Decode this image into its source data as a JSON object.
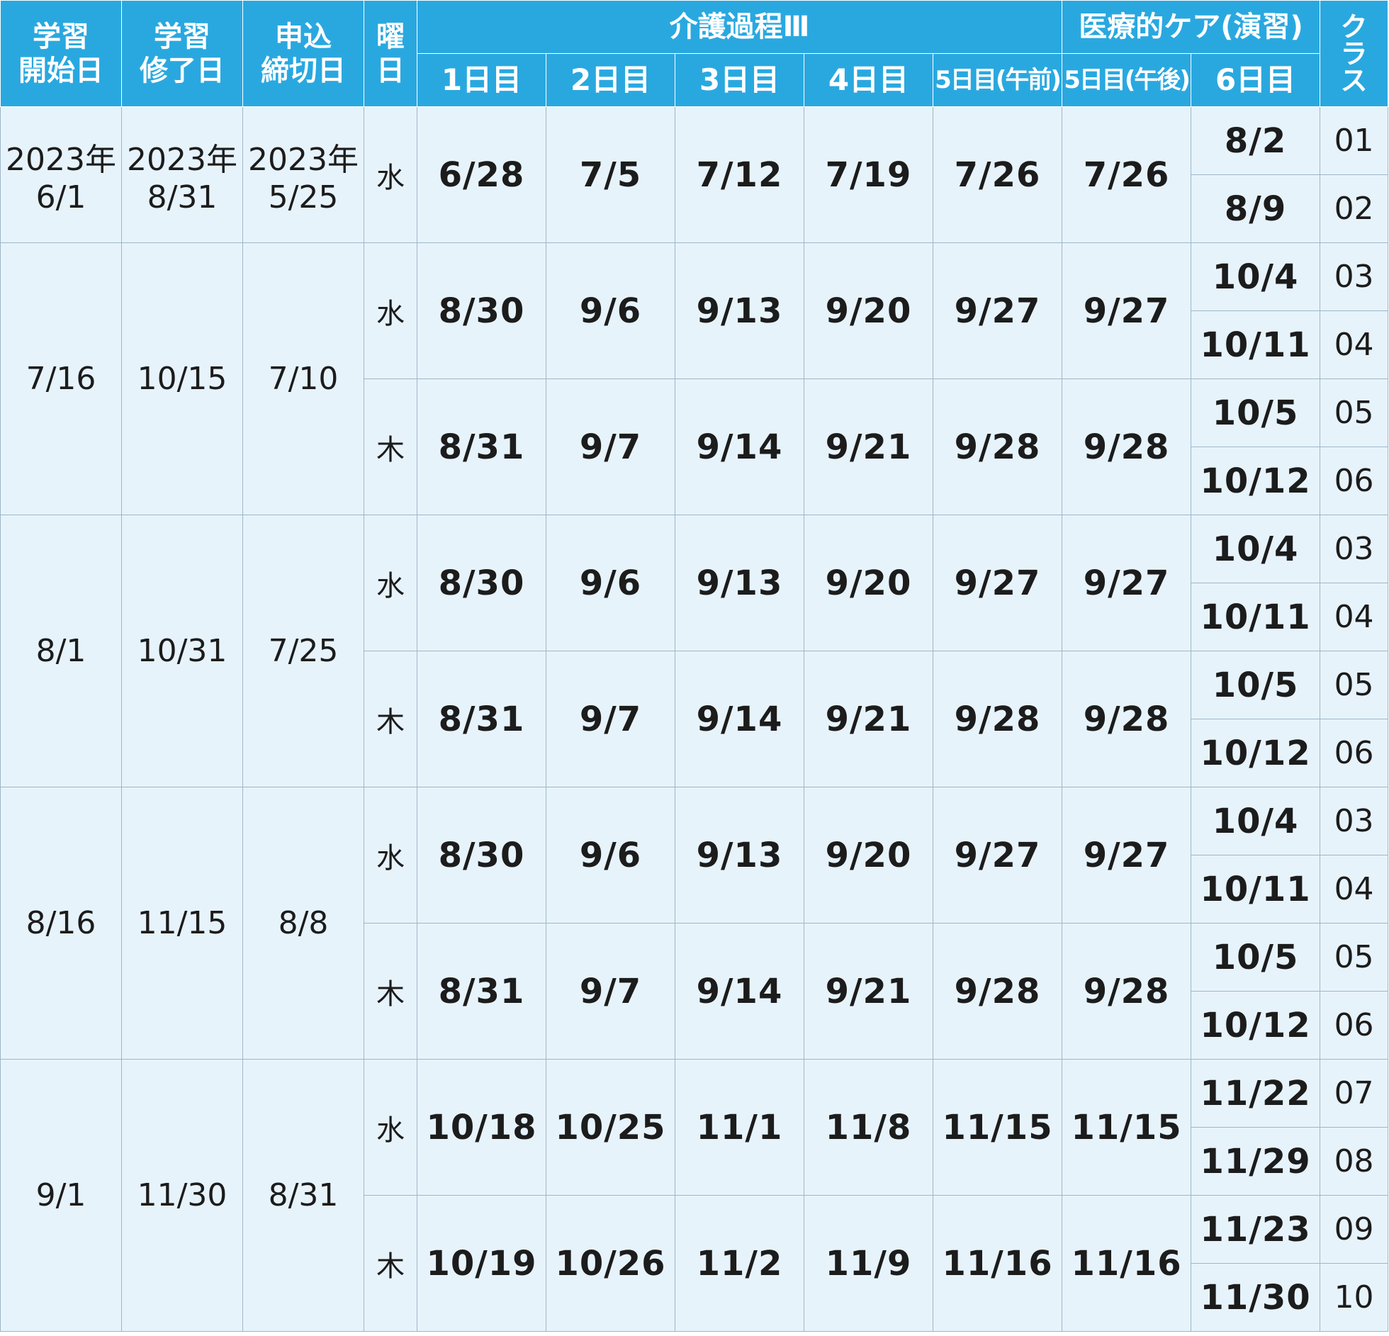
{
  "header": {
    "start_date": "学習\n開始日",
    "end_date": "学習\n修了日",
    "deadline": "申込\n締切日",
    "weekday": "曜\n日",
    "group_kaigo": "介護過程Ⅲ",
    "group_iryo": "医療的ケア(演習)",
    "class": "ク\nラ\nス",
    "days": [
      "1日目",
      "2日目",
      "3日目",
      "4日目",
      "5日目(午前)",
      "5日目(午後)",
      "6日目"
    ]
  },
  "blocks": [
    {
      "start": "2023年\n6/1",
      "end": "2023年\n8/31",
      "deadline": "2023年\n5/25",
      "weeks": [
        {
          "weekday": "水",
          "dates": [
            "6/28",
            "7/5",
            "7/12",
            "7/19",
            "7/26",
            "7/26"
          ],
          "day6": [
            {
              "date": "8/2",
              "class": "01"
            },
            {
              "date": "8/9",
              "class": "02"
            }
          ]
        }
      ]
    },
    {
      "start": "7/16",
      "end": "10/15",
      "deadline": "7/10",
      "weeks": [
        {
          "weekday": "水",
          "dates": [
            "8/30",
            "9/6",
            "9/13",
            "9/20",
            "9/27",
            "9/27"
          ],
          "day6": [
            {
              "date": "10/4",
              "class": "03"
            },
            {
              "date": "10/11",
              "class": "04"
            }
          ]
        },
        {
          "weekday": "木",
          "dates": [
            "8/31",
            "9/7",
            "9/14",
            "9/21",
            "9/28",
            "9/28"
          ],
          "day6": [
            {
              "date": "10/5",
              "class": "05"
            },
            {
              "date": "10/12",
              "class": "06"
            }
          ]
        }
      ]
    },
    {
      "start": "8/1",
      "end": "10/31",
      "deadline": "7/25",
      "weeks": [
        {
          "weekday": "水",
          "dates": [
            "8/30",
            "9/6",
            "9/13",
            "9/20",
            "9/27",
            "9/27"
          ],
          "day6": [
            {
              "date": "10/4",
              "class": "03"
            },
            {
              "date": "10/11",
              "class": "04"
            }
          ]
        },
        {
          "weekday": "木",
          "dates": [
            "8/31",
            "9/7",
            "9/14",
            "9/21",
            "9/28",
            "9/28"
          ],
          "day6": [
            {
              "date": "10/5",
              "class": "05"
            },
            {
              "date": "10/12",
              "class": "06"
            }
          ]
        }
      ]
    },
    {
      "start": "8/16",
      "end": "11/15",
      "deadline": "8/8",
      "weeks": [
        {
          "weekday": "水",
          "dates": [
            "8/30",
            "9/6",
            "9/13",
            "9/20",
            "9/27",
            "9/27"
          ],
          "day6": [
            {
              "date": "10/4",
              "class": "03"
            },
            {
              "date": "10/11",
              "class": "04"
            }
          ]
        },
        {
          "weekday": "木",
          "dates": [
            "8/31",
            "9/7",
            "9/14",
            "9/21",
            "9/28",
            "9/28"
          ],
          "day6": [
            {
              "date": "10/5",
              "class": "05"
            },
            {
              "date": "10/12",
              "class": "06"
            }
          ]
        }
      ]
    },
    {
      "start": "9/1",
      "end": "11/30",
      "deadline": "8/31",
      "weeks": [
        {
          "weekday": "水",
          "dates": [
            "10/18",
            "10/25",
            "11/1",
            "11/8",
            "11/15",
            "11/15"
          ],
          "day6": [
            {
              "date": "11/22",
              "class": "07"
            },
            {
              "date": "11/29",
              "class": "08"
            }
          ]
        },
        {
          "weekday": "木",
          "dates": [
            "10/19",
            "10/26",
            "11/2",
            "11/9",
            "11/16",
            "11/16"
          ],
          "day6": [
            {
              "date": "11/23",
              "class": "09"
            },
            {
              "date": "11/30",
              "class": "10"
            }
          ]
        }
      ]
    }
  ]
}
